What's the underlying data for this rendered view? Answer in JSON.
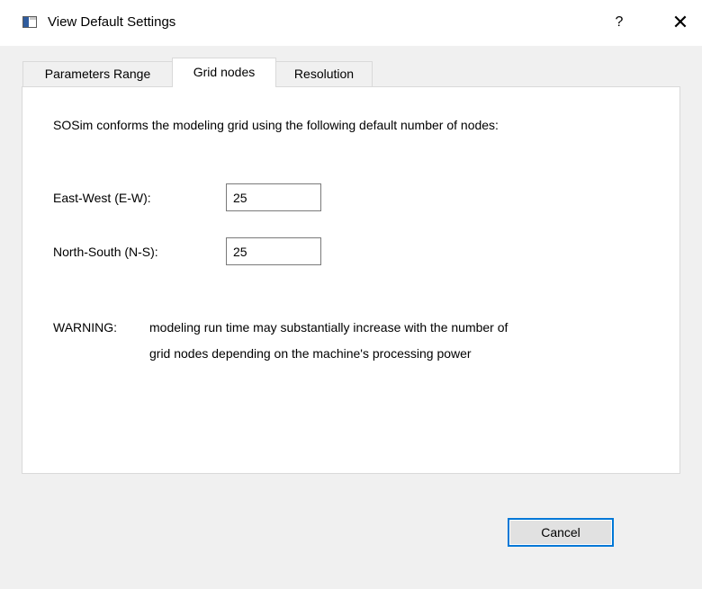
{
  "window": {
    "title": "View Default Settings",
    "help_label": "?",
    "close_label": "✕",
    "app_icon": "app-window-icon"
  },
  "tabs": [
    {
      "label": "Parameters Range",
      "active": false
    },
    {
      "label": "Grid nodes",
      "active": true
    },
    {
      "label": "Resolution",
      "active": false
    }
  ],
  "grid_nodes": {
    "intro": "SOSim conforms the modeling grid using the following default number of nodes:",
    "east_west_label": "East-West (E-W):",
    "east_west_value": "25",
    "north_south_label": "North-South (N-S):",
    "north_south_value": "25",
    "warning_label": "WARNING:",
    "warning_line1": "modeling run time may substantially increase with the number of",
    "warning_line2": "grid nodes depending on the machine's processing power"
  },
  "footer": {
    "cancel_label": "Cancel"
  },
  "colors": {
    "background": "#f0f0f0",
    "panel": "#ffffff",
    "accent": "#0078d7"
  }
}
